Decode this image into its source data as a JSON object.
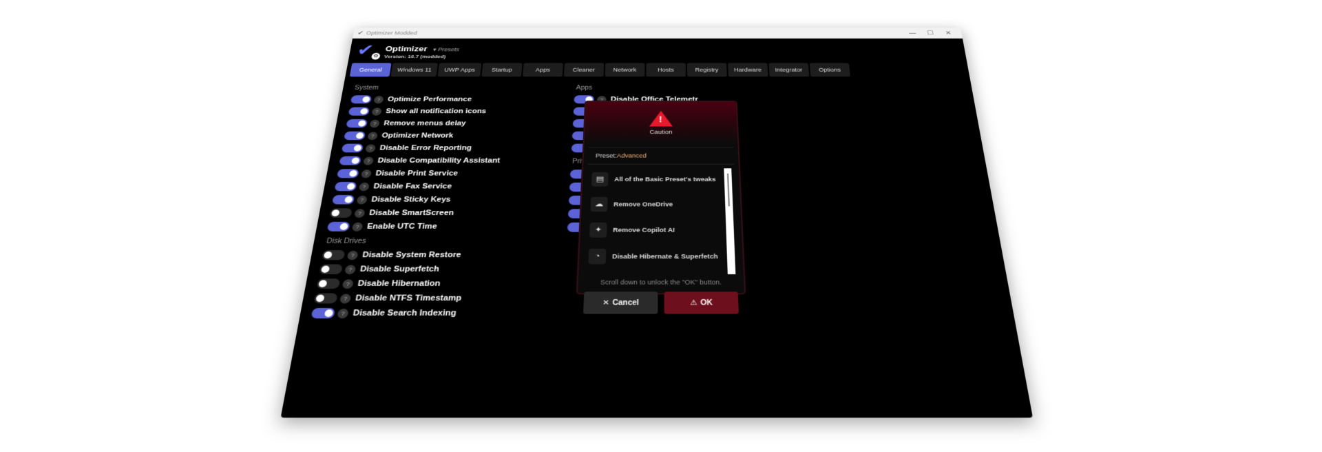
{
  "window": {
    "title": "Optimizer Modded",
    "controls": {
      "minimize": "—",
      "maximize": "☐",
      "close": "✕"
    }
  },
  "header": {
    "app_name": "Optimizer",
    "presets_label": "Presets",
    "version": "Version: 16.7 (modded)"
  },
  "tabs": [
    {
      "label": "General"
    },
    {
      "label": "Windows 11"
    },
    {
      "label": "UWP Apps"
    },
    {
      "label": "Startup"
    },
    {
      "label": "Apps"
    },
    {
      "label": "Cleaner"
    },
    {
      "label": "Network"
    },
    {
      "label": "Hosts"
    },
    {
      "label": "Registry"
    },
    {
      "label": "Hardware"
    },
    {
      "label": "Integrator"
    },
    {
      "label": "Options"
    }
  ],
  "left": {
    "system_label": "System",
    "system": [
      {
        "label": "Optimize Performance",
        "on": true
      },
      {
        "label": "Show all notification icons",
        "on": true
      },
      {
        "label": "Remove menus delay",
        "on": true
      },
      {
        "label": "Optimizer Network",
        "on": true
      },
      {
        "label": "Disable Error Reporting",
        "on": true
      },
      {
        "label": "Disable Compatibility Assistant",
        "on": true
      },
      {
        "label": "Disable Print Service",
        "on": true
      },
      {
        "label": "Disable Fax Service",
        "on": true
      },
      {
        "label": "Disable Sticky Keys",
        "on": true
      },
      {
        "label": "Disable SmartScreen",
        "on": false
      },
      {
        "label": "Enable UTC Time",
        "on": true
      }
    ],
    "disk_label": "Disk Drives",
    "disk": [
      {
        "label": "Disable System Restore",
        "on": false
      },
      {
        "label": "Disable Superfetch",
        "on": false
      },
      {
        "label": "Disable Hibernation",
        "on": false
      },
      {
        "label": "Disable NTFS Timestamp",
        "on": false
      },
      {
        "label": "Disable Search Indexing",
        "on": true
      }
    ]
  },
  "right": {
    "apps_label": "Apps",
    "apps_first_label_partial": "Disable Office Telemetr",
    "privacy_label_partial": "Priva"
  },
  "help_glyph": "?",
  "modal": {
    "caution": "Caution",
    "warning_glyph": "!",
    "preset_prefix": "Preset:",
    "preset_value": "Advanced",
    "items": [
      {
        "icon": "▤",
        "label": "All of the Basic Preset's tweaks"
      },
      {
        "icon": "☁",
        "label": "Remove OneDrive"
      },
      {
        "icon": "✦",
        "label": "Remove Copilot AI"
      },
      {
        "icon": "◔",
        "label": "Disable Hibernate & Superfetch"
      }
    ],
    "hint": "Scroll down to unlock the \"OK\" button.",
    "cancel_label": "Cancel",
    "ok_label": "OK"
  },
  "colors": {
    "accent": "#5b63d6",
    "danger": "#e8192c",
    "ok_button": "#6d0f1c"
  }
}
